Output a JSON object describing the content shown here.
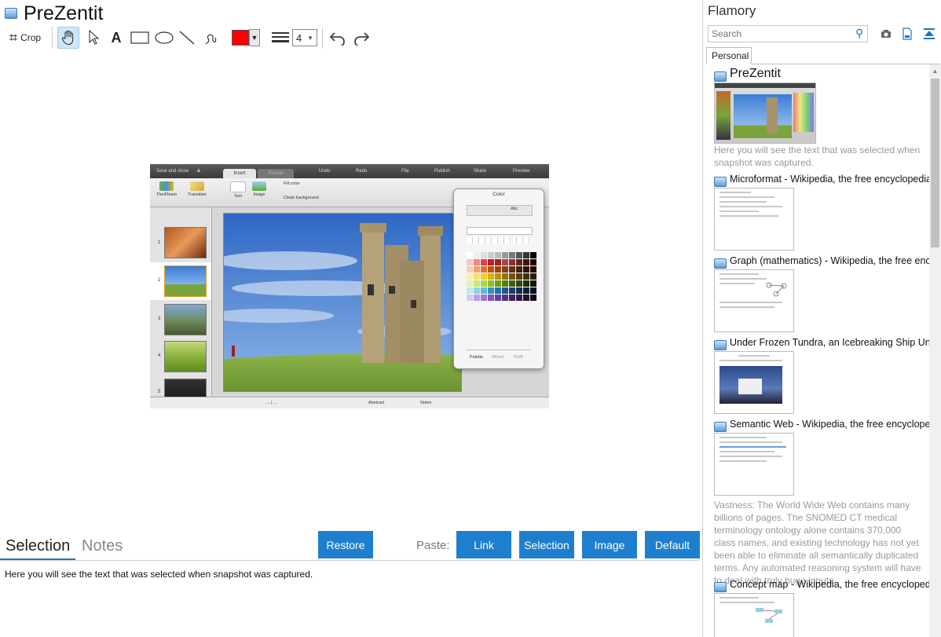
{
  "app": {
    "title": "PreZentit"
  },
  "toolbar": {
    "crop_label": "Crop",
    "text_tool": "A",
    "line_width": "4",
    "color": "#ff0000"
  },
  "snapshot": {
    "topbar": {
      "save_close": "Save and close",
      "tab_insert": "Insert",
      "tab_format": "Format",
      "undo": "Undo",
      "redo": "Redo",
      "file": "File",
      "publish": "Publish",
      "share": "Share",
      "preview": "Preview"
    },
    "ribbon": {
      "theateam": "TheATeam",
      "transition": "Transition",
      "text": "Text",
      "image": "Image",
      "fill_color": "Fill color",
      "clean_bg": "Clean background"
    },
    "slides": [
      "1",
      "2",
      "3",
      "4",
      "5"
    ],
    "color_panel": {
      "title": "Color",
      "tab_text": "Abc",
      "palette": "Palette",
      "wheel": "Wheel",
      "rgb": "RGB"
    },
    "bottom": {
      "dots": "... | ...",
      "abstract": "Abstract",
      "notes": "Notes"
    }
  },
  "bottom_panel": {
    "tab_selection": "Selection",
    "tab_notes": "Notes",
    "restore": "Restore",
    "paste_label": "Paste:",
    "link": "Link",
    "selection": "Selection",
    "image": "Image",
    "default": "Default",
    "selection_text": "Here you will see the text that was selected when snapshot was captured."
  },
  "sidebar": {
    "title": "Flamory",
    "search_placeholder": "Search",
    "tab_personal": "Personal",
    "items": [
      {
        "title": "PreZentit",
        "desc": "Here you will see the text that was selected when snapshot was captured."
      },
      {
        "title": "Microformat - Wikipedia, the free encyclopedia"
      },
      {
        "title": "Graph (mathematics) - Wikipedia, the free ency"
      },
      {
        "title": "Under Frozen Tundra, an Icebreaking Ship Unco"
      },
      {
        "title": "Semantic Web - Wikipedia, the free encycloped",
        "desc": "Vastness: The World Wide Web contains many billions of pages. The SNOMED CT medical terminology ontology alone contains 370,000 class names, and existing technology has not yet been able to eliminate all semantically duplicated terms. Any automated reasoning system will have to deal with truly huge inputs."
      },
      {
        "title": "Concept map - Wikipedia, the free encyclopedia"
      }
    ]
  }
}
